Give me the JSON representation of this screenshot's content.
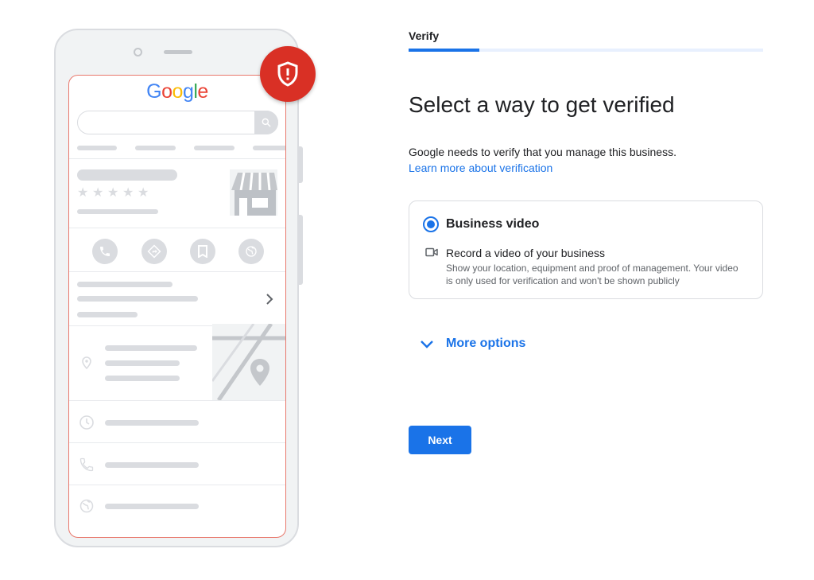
{
  "illustration": {
    "logo_text": "Google",
    "star_glyphs": [
      "★",
      "★",
      "★",
      "★",
      "★"
    ]
  },
  "step": {
    "label": "Verify",
    "progress": 0.2
  },
  "main": {
    "title": "Select a way to get verified",
    "description": "Google needs to verify that you manage this business.",
    "learn_more": "Learn more about verification"
  },
  "option": {
    "title": "Business video",
    "selected": true,
    "subtitle": "Record a video of your business",
    "description": "Show your location, equipment and proof of management. Your video is only used for verification and won't be shown publicly"
  },
  "more_options": {
    "label": "More options"
  },
  "actions": {
    "next_label": "Next"
  },
  "icons": {
    "shield": "shield-alert-icon",
    "search": "search-icon",
    "video": "video-camera-icon",
    "chevron": "chevron-down-icon",
    "phone": "phone-icon",
    "directions": "directions-icon",
    "bookmark": "bookmark-icon",
    "globe": "globe-icon",
    "pin": "location-pin-icon",
    "clock": "clock-icon"
  },
  "colors": {
    "accent": "#1a73e8",
    "alert": "#d93025",
    "screen_border": "#e8786c",
    "placeholder": "#dadce0"
  }
}
